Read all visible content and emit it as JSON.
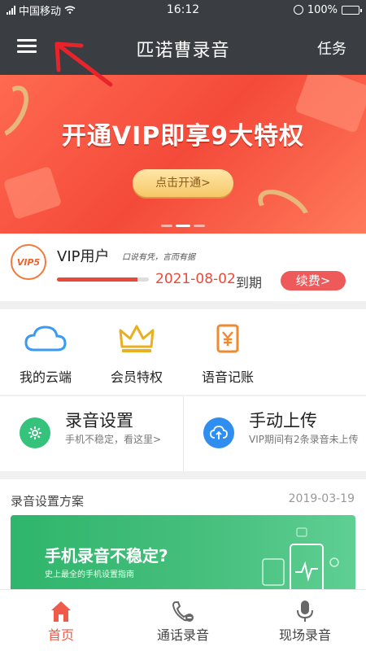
{
  "status_bar": {
    "carrier": "中国移动",
    "time": "16:12",
    "battery": "100%",
    "icons": [
      "signal-icon",
      "wifi-icon",
      "alarm-icon",
      "battery-icon"
    ]
  },
  "nav": {
    "title": "匹诺曹录音",
    "right_action": "任务",
    "menu_icon": "hamburger-menu-icon"
  },
  "banner": {
    "headline": "开通VIP即享9大特权",
    "button_label": "点击开通>",
    "page_indicator": {
      "pages": 3,
      "active": 2
    },
    "colors": {
      "background": "#f44a3a",
      "button": "#f5c868"
    }
  },
  "vip": {
    "badge": "VIP5",
    "name": "VIP用户",
    "slogan": "口说有凭，言而有据",
    "expiry_date": "2021-08-02",
    "expiry_suffix": "到期",
    "renew_label": "续费>",
    "progress": 0.88
  },
  "features": [
    {
      "label": "我的云端",
      "icon": "cloud-icon"
    },
    {
      "label": "会员特权",
      "icon": "crown-icon"
    },
    {
      "label": "语音记账",
      "icon": "yuan-ledger-icon"
    }
  ],
  "quick_actions": [
    {
      "title": "录音设置",
      "subtitle": "手机不稳定，看这里>",
      "icon": "settings-gear-icon",
      "color": "#35c27a"
    },
    {
      "title": "手动上传",
      "subtitle": "VIP期间有2条录音未上传",
      "icon": "cloud-upload-icon",
      "color": "#2f8ef0"
    }
  ],
  "section": {
    "title": "录音设置方案",
    "date": "2019-03-19",
    "promo_title": "手机录音不稳定?",
    "promo_subtitle": "史上最全的手机设置指南"
  },
  "tabs": [
    {
      "label": "首页",
      "icon": "home-icon",
      "active": true
    },
    {
      "label": "通话录音",
      "icon": "phone-record-icon",
      "active": false
    },
    {
      "label": "现场录音",
      "icon": "microphone-icon",
      "active": false
    }
  ],
  "accent_color": "#f05a4a"
}
